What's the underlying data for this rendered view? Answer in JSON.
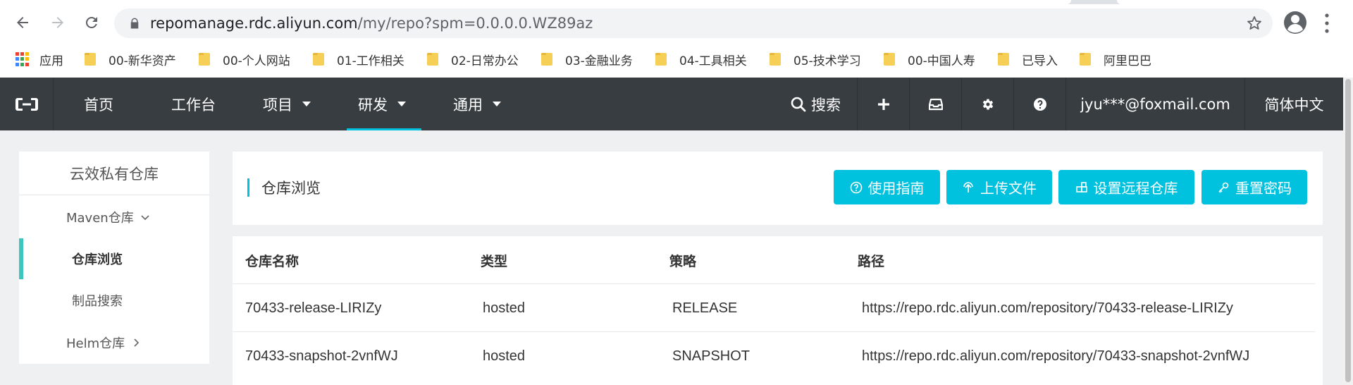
{
  "browser": {
    "url_host": "repomanage.rdc.aliyun.com",
    "url_path": "/my/repo?spm=0.0.0.0.WZ89az"
  },
  "bookmarks": {
    "apps_label": "应用",
    "items": [
      "00-新华资产",
      "00-个人网站",
      "01-工作相关",
      "02-日常办公",
      "03-金融业务",
      "04-工具相关",
      "05-技术学习",
      "00-中国人寿",
      "已导入",
      "阿里巴巴"
    ]
  },
  "topnav": {
    "items": [
      {
        "label": "首页",
        "dropdown": false
      },
      {
        "label": "工作台",
        "dropdown": false
      },
      {
        "label": "项目",
        "dropdown": true
      },
      {
        "label": "研发",
        "dropdown": true
      },
      {
        "label": "通用",
        "dropdown": true
      }
    ],
    "search_label": "搜索",
    "user_email": "jyu***@foxmail.com",
    "language": "简体中文",
    "active_color": "#00c1de",
    "bg_color": "#373d41"
  },
  "sidebar": {
    "title": "云效私有仓库",
    "items": [
      {
        "label": "Maven仓库",
        "expanded": true
      },
      {
        "label": "仓库浏览",
        "active": true
      },
      {
        "label": "制品搜索"
      },
      {
        "label": "Helm仓库",
        "expanded": false
      }
    ]
  },
  "header": {
    "title": "仓库浏览",
    "buttons": {
      "guide": "使用指南",
      "upload": "上传文件",
      "remote": "设置远程仓库",
      "reset": "重置密码"
    }
  },
  "table": {
    "columns": [
      "仓库名称",
      "类型",
      "策略",
      "路径"
    ],
    "rows": [
      [
        "70433-release-LIRIZy",
        "hosted",
        "RELEASE",
        "https://repo.rdc.aliyun.com/repository/70433-release-LIRIZy"
      ],
      [
        "70433-snapshot-2vnfWJ",
        "hosted",
        "SNAPSHOT",
        "https://repo.rdc.aliyun.com/repository/70433-snapshot-2vnfWJ"
      ]
    ]
  }
}
